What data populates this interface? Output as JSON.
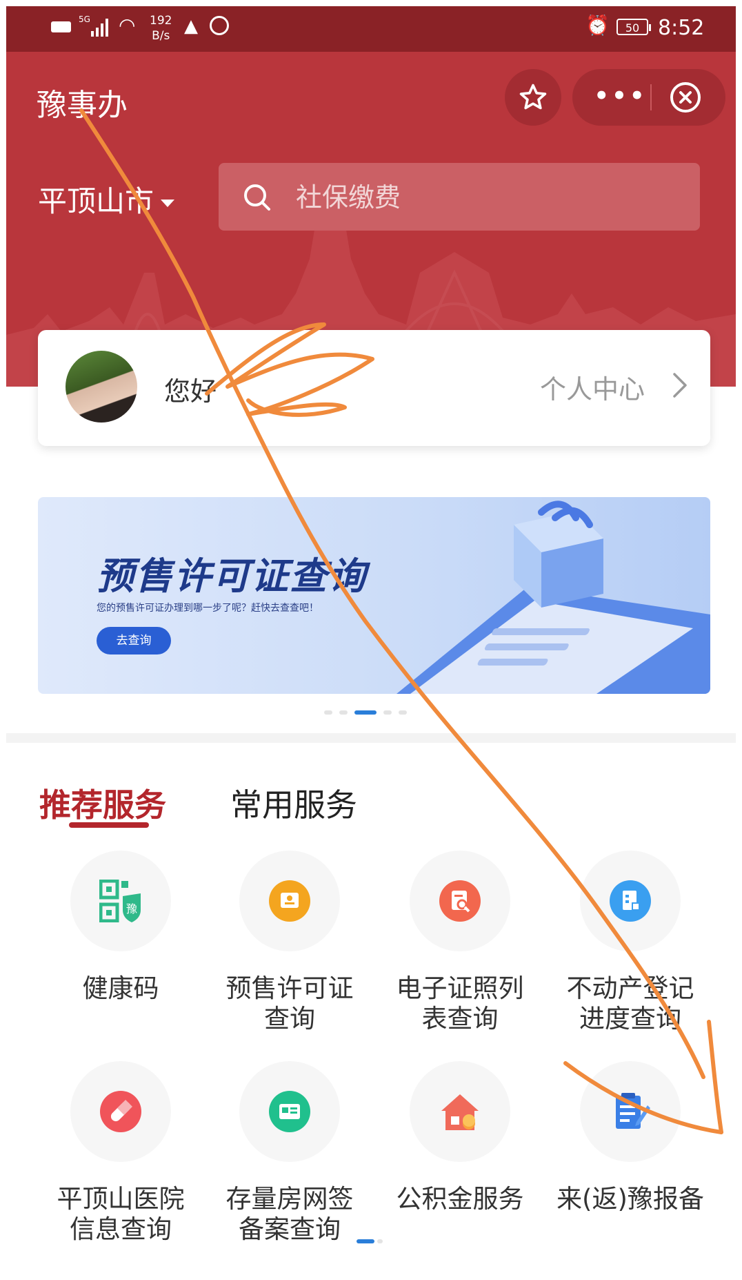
{
  "status_bar": {
    "hd": "HD",
    "network": "5G",
    "speed_value": "192",
    "speed_unit": "B/s",
    "battery": "50",
    "time": "8:52"
  },
  "header": {
    "app_title": "豫事办",
    "city": "平顶山市",
    "search_placeholder": "社保缴费"
  },
  "user_card": {
    "greeting": "您好",
    "profile_link": "个人中心"
  },
  "banner": {
    "title": "预售许可证查询",
    "subtitle": "您的预售许可证办理到哪一步了呢？赶快去查查吧！",
    "button": "去查询"
  },
  "tabs": [
    {
      "label": "推荐服务",
      "active": true
    },
    {
      "label": "常用服务",
      "active": false
    }
  ],
  "services": [
    {
      "label": "健康码",
      "icon": "health-code-icon",
      "color": "#2fb98a"
    },
    {
      "label": "预售许可证查询",
      "icon": "presale-permit-icon",
      "color": "#f4a51f"
    },
    {
      "label": "电子证照列表查询",
      "icon": "e-license-icon",
      "color": "#f2674e"
    },
    {
      "label": "不动产登记进度查询",
      "icon": "real-estate-icon",
      "color": "#3a9ff0"
    },
    {
      "label": "平顶山医院信息查询",
      "icon": "hospital-icon",
      "color": "#f0545a"
    },
    {
      "label": "存量房网签备案查询",
      "icon": "house-contract-icon",
      "color": "#20c08d"
    },
    {
      "label": "公积金服务",
      "icon": "housing-fund-icon",
      "color": "#f06a5a"
    },
    {
      "label": "来(返)豫报备",
      "icon": "report-icon",
      "color": "#3a7fe6"
    }
  ],
  "colors": {
    "header_red": "#b9363c",
    "accent_red": "#b3262c",
    "accent_blue": "#2a7ed9"
  }
}
